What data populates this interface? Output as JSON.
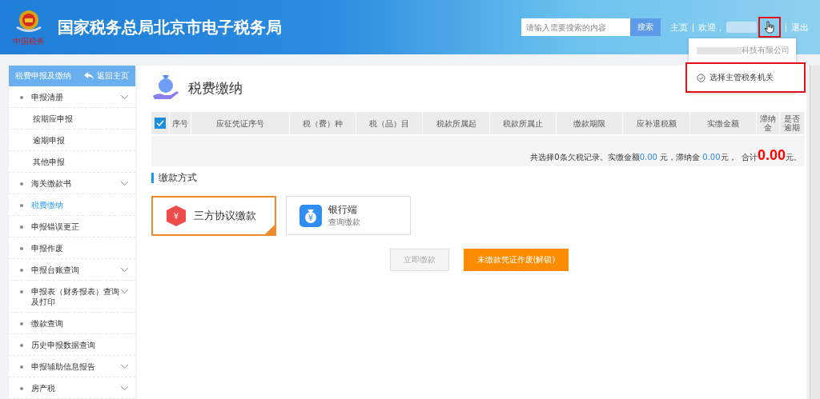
{
  "header": {
    "logo_caption": "中国税务",
    "title": "国家税务总局北京市电子税务局",
    "search": {
      "placeholder": "请输入需要搜索的内容",
      "button": "搜索"
    },
    "nav": {
      "home": "主页",
      "welcome": "欢迎，",
      "logout": "退出"
    },
    "user_menu": {
      "company": "科技有限公司",
      "items": [
        {
          "label": "选择主管税务机关",
          "highlighted": true
        }
      ]
    }
  },
  "sidebar": {
    "title": "税费申报及缴纳",
    "back": "返回主页",
    "items": [
      {
        "label": "申报清册",
        "expandable": true,
        "selected": false,
        "children": [
          {
            "label": "按期应申报",
            "selected": false
          },
          {
            "label": "逾期申报",
            "selected": false
          },
          {
            "label": "其他申报",
            "selected": false
          }
        ]
      },
      {
        "label": "海关缴款书",
        "expandable": true,
        "selected": false
      },
      {
        "label": "税费缴纳",
        "expandable": false,
        "selected": true
      },
      {
        "label": "申报错误更正",
        "expandable": false,
        "selected": false
      },
      {
        "label": "申报作废",
        "expandable": false,
        "selected": false
      },
      {
        "label": "申报台账查询",
        "expandable": true,
        "selected": false
      },
      {
        "label": "申报表（财务报表）查询及打印",
        "expandable": true,
        "selected": false
      },
      {
        "label": "缴款查询",
        "expandable": false,
        "selected": false
      },
      {
        "label": "历史申报数据查询",
        "expandable": false,
        "selected": false
      },
      {
        "label": "申报辅助信息报告",
        "expandable": true,
        "selected": false
      },
      {
        "label": "房产税",
        "expandable": true,
        "selected": false
      }
    ]
  },
  "page": {
    "title": "税费缴纳",
    "table": {
      "select_all_checked": true,
      "columns": [
        "序号",
        "应征凭证序号",
        "税（费）种",
        "税（品）目",
        "税款所属起",
        "税款所属止",
        "缴款期限",
        "应补退税额",
        "实缴金额",
        "滞纳金",
        "是否逾期"
      ]
    },
    "summary": [
      {
        "kind": "text",
        "text": "共选择0条欠税记录。实缴金额"
      },
      {
        "kind": "amount",
        "text": "0.00"
      },
      {
        "kind": "text",
        "text": " 元，滞纳金 "
      },
      {
        "kind": "amount",
        "text": "0.00"
      },
      {
        "kind": "text",
        "text": "元，  合计"
      },
      {
        "kind": "total",
        "text": "0.00"
      },
      {
        "kind": "text",
        "text": "元。"
      }
    ],
    "payment_section": "缴款方式",
    "methods": [
      {
        "kind": "tripartite",
        "icon_text": "¥",
        "title": "三方协议缴款",
        "selected": true
      },
      {
        "kind": "bank",
        "icon_text": "¥",
        "title": "银行端",
        "subtitle": "查询缴款",
        "selected": false
      }
    ],
    "buttons": [
      {
        "label": "立即缴款",
        "kind": "default",
        "disabled": true
      },
      {
        "label": "未缴款凭证作废(解锁)",
        "kind": "primary",
        "disabled": false
      }
    ]
  }
}
